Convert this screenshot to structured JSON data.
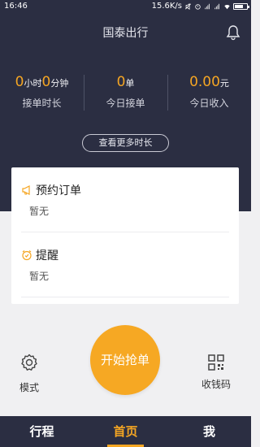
{
  "status_bar": {
    "time": "16:46",
    "network_speed": "15.6K/s",
    "icons": [
      "mute-icon",
      "alarm-icon",
      "signal-icon",
      "signal-icon",
      "wifi-icon",
      "battery-icon"
    ]
  },
  "header": {
    "title": "国泰出行",
    "bell_icon": "bell-icon"
  },
  "stats": [
    {
      "value_parts": [
        "0",
        "小时",
        "0",
        "分钟"
      ],
      "label": "接单时长"
    },
    {
      "value_parts": [
        "0",
        "单"
      ],
      "label": "今日接单"
    },
    {
      "value_parts": [
        "0.00",
        "元"
      ],
      "label": "今日收入"
    }
  ],
  "more_button": "查看更多时长",
  "card": {
    "orders": {
      "title": "预约订单",
      "icon": "megaphone-icon",
      "empty_text": "暂无"
    },
    "reminder": {
      "title": "提醒",
      "icon": "alarm-clock-icon",
      "empty_text": "暂无"
    }
  },
  "actions": {
    "mode_label": "模式",
    "grab_label": "开始抢单",
    "qr_label": "收钱码"
  },
  "tabs": [
    {
      "label": "行程",
      "active": false
    },
    {
      "label": "首页",
      "active": true
    },
    {
      "label": "我",
      "active": false
    }
  ],
  "colors": {
    "dark_bg": "#2b2e42",
    "accent": "#f5a623",
    "page_bg": "#f0f0f2"
  }
}
